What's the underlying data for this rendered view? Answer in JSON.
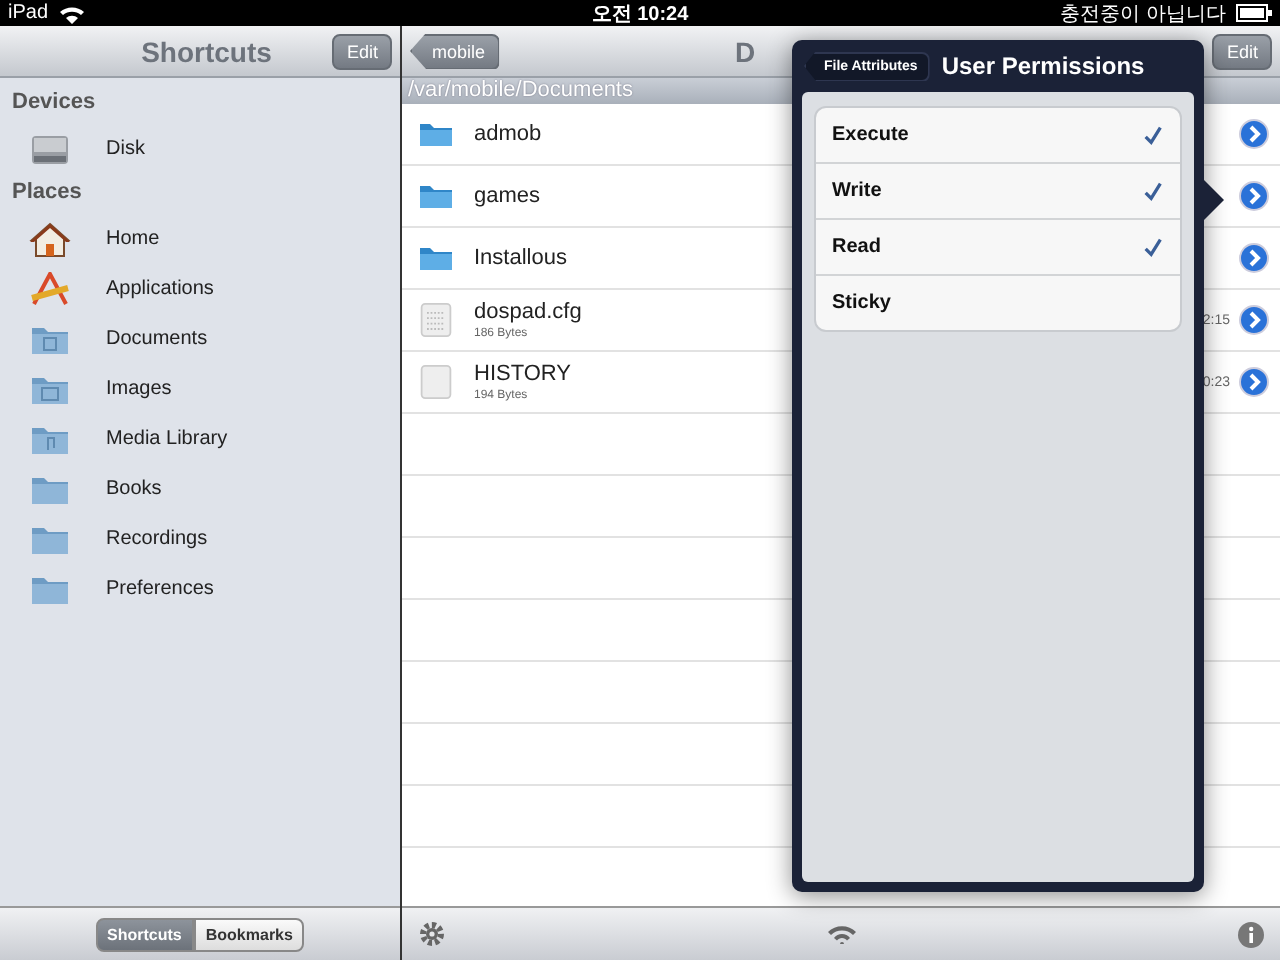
{
  "status_bar": {
    "device": "iPad",
    "time": "오전 10:24",
    "battery_text": "충전중이 아닙니다"
  },
  "sidebar": {
    "title": "Shortcuts",
    "edit_button": "Edit",
    "sections": [
      {
        "title": "Devices",
        "items": [
          {
            "label": "Disk",
            "kind": "disk"
          }
        ]
      },
      {
        "title": "Places",
        "items": [
          {
            "label": "Home",
            "kind": "home"
          },
          {
            "label": "Applications",
            "kind": "apps"
          },
          {
            "label": "Documents",
            "kind": "folder-doc"
          },
          {
            "label": "Images",
            "kind": "folder-img"
          },
          {
            "label": "Media Library",
            "kind": "folder-music"
          },
          {
            "label": "Books",
            "kind": "folder"
          },
          {
            "label": "Recordings",
            "kind": "folder"
          },
          {
            "label": "Preferences",
            "kind": "folder"
          }
        ]
      }
    ],
    "segments": [
      {
        "label": "Shortcuts",
        "selected": true
      },
      {
        "label": "Bookmarks",
        "selected": false
      }
    ]
  },
  "main": {
    "back_button": "mobile",
    "title": "D",
    "edit_button": "Edit",
    "path": "/var/mobile/Documents",
    "files": [
      {
        "name": "admob",
        "kind": "folder"
      },
      {
        "name": "games",
        "kind": "folder"
      },
      {
        "name": "Installous",
        "kind": "folder"
      },
      {
        "name": "dospad.cfg",
        "kind": "file",
        "size": "186 Bytes",
        "time": "2:15"
      },
      {
        "name": "HISTORY",
        "kind": "blank",
        "size": "194 Bytes",
        "time": "0:23"
      }
    ]
  },
  "popover": {
    "back_button": "File Attributes",
    "title": "User Permissions",
    "options": [
      {
        "label": "Execute",
        "checked": true
      },
      {
        "label": "Write",
        "checked": true
      },
      {
        "label": "Read",
        "checked": true
      },
      {
        "label": "Sticky",
        "checked": false
      }
    ]
  }
}
